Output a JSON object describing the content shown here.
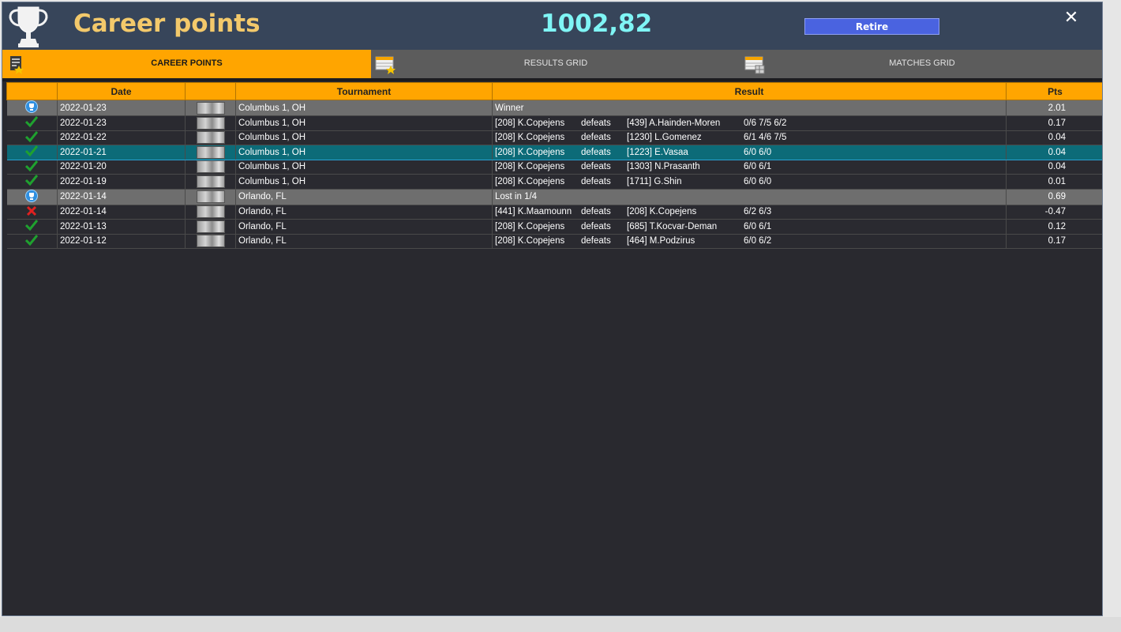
{
  "header": {
    "title": "Career points",
    "points": "1002,82",
    "retire_label": "Retire",
    "close_glyph": "✕"
  },
  "tabs": [
    {
      "label": "CAREER POINTS",
      "icon": "career-points-icon",
      "active": true
    },
    {
      "label": "RESULTS GRID",
      "icon": "results-grid-icon",
      "active": false
    },
    {
      "label": "MATCHES GRID",
      "icon": "matches-grid-icon",
      "active": false
    }
  ],
  "table": {
    "columns": [
      "",
      "Date",
      "",
      "Tournament",
      "Result",
      "Pts"
    ],
    "rows": [
      {
        "icon": "trophy-medal-icon",
        "type": "summary",
        "date": "2022-01-23",
        "tournament": "Columbus 1, OH",
        "result": "Winner",
        "pts": "2.01"
      },
      {
        "icon": "check-icon",
        "type": "normal",
        "date": "2022-01-23",
        "tournament": "Columbus 1, OH",
        "p1": "[208]  K.Copejens",
        "verb": "defeats",
        "p2": "[439] A.Hainden-Moren",
        "score": "0/6 7/5 6/2",
        "pts": "0.17"
      },
      {
        "icon": "check-icon",
        "type": "normal",
        "date": "2022-01-22",
        "tournament": "Columbus 1, OH",
        "p1": "[208]  K.Copejens",
        "verb": "defeats",
        "p2": "[1230] L.Gomenez",
        "score": "6/1 4/6 7/5",
        "pts": "0.04"
      },
      {
        "icon": "check-icon",
        "type": "selected",
        "date": "2022-01-21",
        "tournament": "Columbus 1, OH",
        "p1": "[208]  K.Copejens",
        "verb": "defeats",
        "p2": "[1223] E.Vasaa",
        "score": "6/0 6/0",
        "pts": "0.04"
      },
      {
        "icon": "check-icon",
        "type": "normal",
        "date": "2022-01-20",
        "tournament": "Columbus 1, OH",
        "p1": "[208]  K.Copejens",
        "verb": "defeats",
        "p2": "[1303] N.Prasanth",
        "score": "6/0 6/1",
        "pts": "0.04"
      },
      {
        "icon": "check-icon",
        "type": "normal",
        "date": "2022-01-19",
        "tournament": "Columbus 1, OH",
        "p1": "[208]  K.Copejens",
        "verb": "defeats",
        "p2": "[1711] G.Shin",
        "score": "6/0 6/0",
        "pts": "0.01"
      },
      {
        "icon": "trophy-medal-icon",
        "type": "summary",
        "date": "2022-01-14",
        "tournament": "Orlando, FL",
        "result": "Lost in 1/4",
        "pts": "0.69"
      },
      {
        "icon": "cross-icon",
        "type": "normal",
        "date": "2022-01-14",
        "tournament": "Orlando, FL",
        "p1": "[441]  K.Maamounn",
        "verb": "defeats",
        "p2": "[208] K.Copejens",
        "score": "6/2 6/3",
        "pts": "-0.47"
      },
      {
        "icon": "check-icon",
        "type": "normal",
        "date": "2022-01-13",
        "tournament": "Orlando, FL",
        "p1": "[208]  K.Copejens",
        "verb": "defeats",
        "p2": "[685] T.Kocvar-Deman",
        "score": "6/0 6/1",
        "pts": "0.12"
      },
      {
        "icon": "check-icon",
        "type": "normal",
        "date": "2022-01-12",
        "tournament": "Orlando, FL",
        "p1": "[208]  K.Copejens",
        "verb": "defeats",
        "p2": "[464] M.Podzirus",
        "score": "6/0 6/2",
        "pts": "0.17"
      }
    ]
  },
  "colors": {
    "accent_orange": "#ffa500",
    "title_gold": "#f3c96b",
    "points_cyan": "#7ff5f5",
    "retire_blue": "#4a63e0",
    "selected_teal": "#0c6b78",
    "win_green": "#1fa12f",
    "loss_red": "#e02020"
  }
}
